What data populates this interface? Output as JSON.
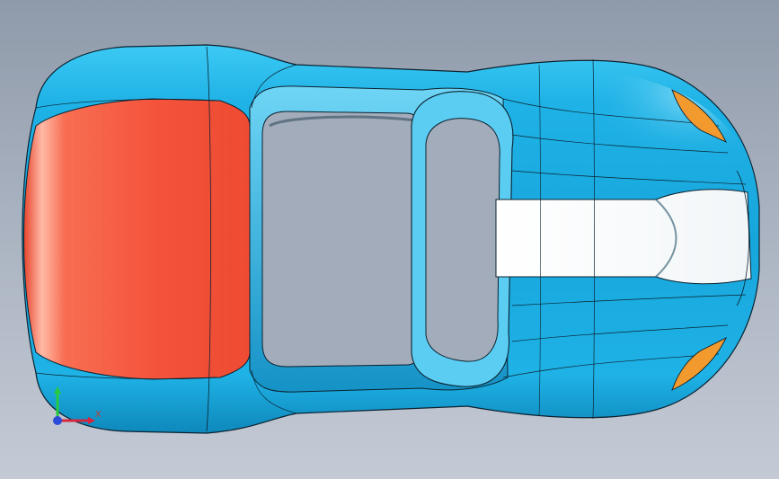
{
  "viewport": {
    "background_top": "#8f9aaa",
    "background_bottom": "#c4cad5"
  },
  "model": {
    "body_color": "#21b8ea",
    "body_shade": "#0f8fc2",
    "body_highlight": "#9fe6ff",
    "rear_panel_color": "#f4523a",
    "front_stripe_color": "#ffffff",
    "headlight_color": "#f39a2e",
    "edge_color": "#0b2230"
  },
  "triad": {
    "x_label": "X",
    "x_color": "#d7263d",
    "y_color": "#27c93f",
    "z_color": "#2b4bd8"
  }
}
